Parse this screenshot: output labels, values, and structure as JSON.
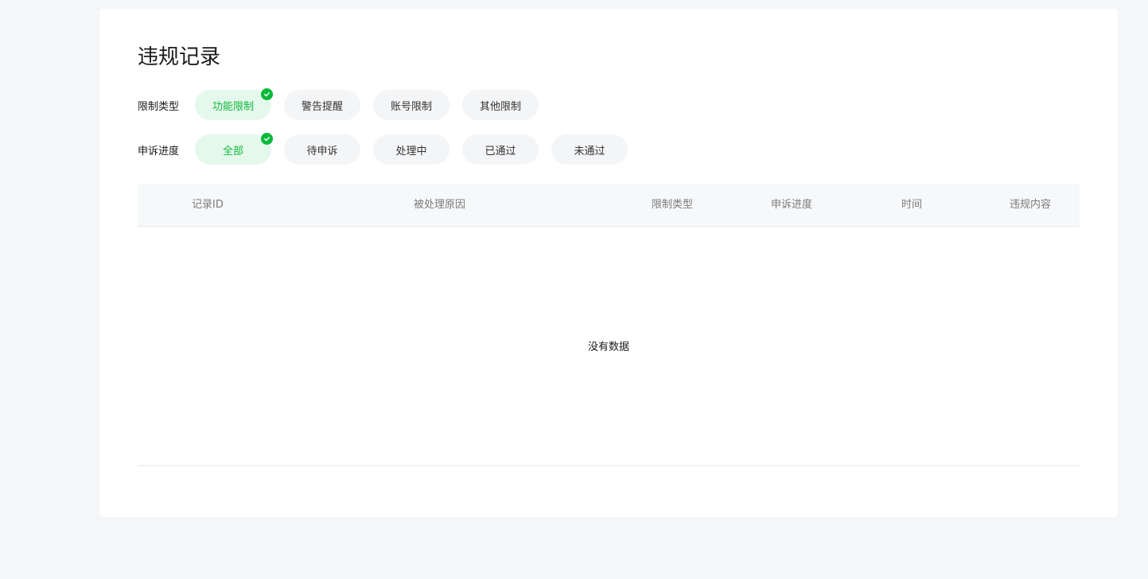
{
  "page": {
    "title": "违规记录"
  },
  "filters": {
    "restriction_type": {
      "label": "限制类型",
      "options": [
        "功能限制",
        "警告提醒",
        "账号限制",
        "其他限制"
      ],
      "selected": "功能限制"
    },
    "appeal_progress": {
      "label": "申诉进度",
      "options": [
        "全部",
        "待申诉",
        "处理中",
        "已通过",
        "未通过"
      ],
      "selected": "全部"
    }
  },
  "table": {
    "columns": [
      "记录ID",
      "被处理原因",
      "限制类型",
      "申诉进度",
      "时间",
      "违规内容"
    ],
    "rows": [],
    "empty_text": "没有数据"
  },
  "colors": {
    "accent": "#07b83a",
    "selected_bg": "#e5f8ec",
    "chip_bg": "#f4f5f7",
    "page_bg": "#f5f6f7"
  },
  "icons": {
    "selected_badge": "check-icon"
  }
}
